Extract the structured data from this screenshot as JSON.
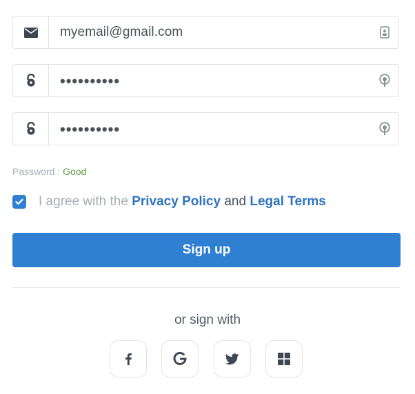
{
  "form": {
    "email": {
      "value": "myemail@gmail.com",
      "leading_icon": "envelope-icon",
      "trailing_icon": "contact-card-icon"
    },
    "password": {
      "value": "••••••••••",
      "leading_icon": "unlock-icon",
      "trailing_icon": "key-icon"
    },
    "confirm_password": {
      "value": "••••••••••",
      "leading_icon": "unlock-icon",
      "trailing_icon": "key-icon"
    },
    "strength": {
      "label": "Password :",
      "value": "Good",
      "value_color": "#5a9b43"
    },
    "agree": {
      "checked": true,
      "prefix": "I agree with the",
      "privacy_link": "Privacy Policy",
      "conjunction": "and",
      "terms_link": "Legal Terms"
    },
    "submit_label": "Sign up"
  },
  "social": {
    "heading": "or sign with",
    "providers": [
      {
        "name": "facebook",
        "icon": "facebook-icon"
      },
      {
        "name": "google",
        "icon": "google-icon"
      },
      {
        "name": "twitter",
        "icon": "twitter-icon"
      },
      {
        "name": "microsoft",
        "icon": "windows-icon"
      }
    ]
  },
  "colors": {
    "accent": "#2f7fd3",
    "link": "#2f74bf",
    "muted": "#a7adb5",
    "border": "#dfe2e6"
  }
}
